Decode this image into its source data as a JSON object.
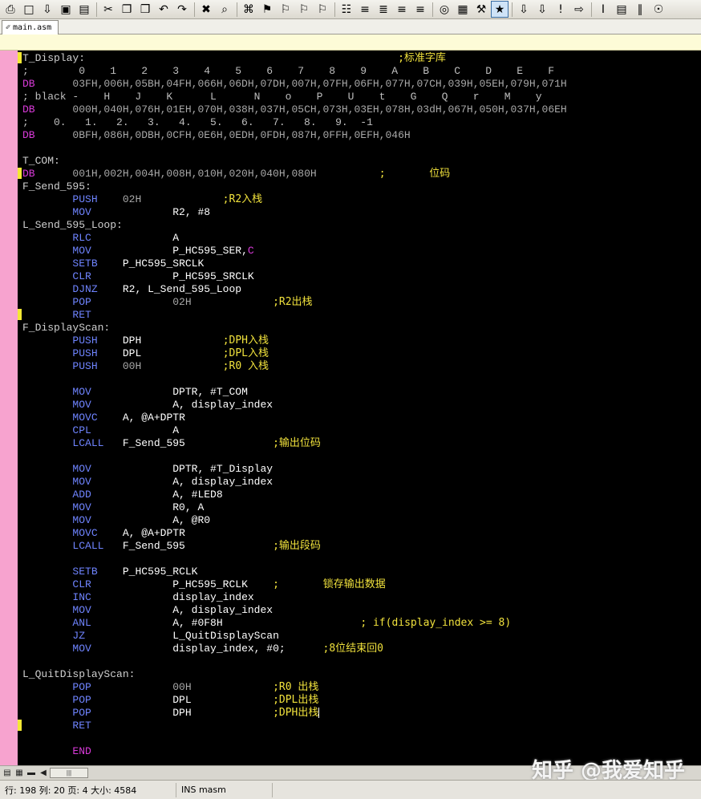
{
  "toolbar": {
    "icons": [
      "⎙",
      "□",
      "⇩",
      "▣",
      "▤",
      "✂",
      "❐",
      "❒",
      "↶",
      "↷",
      "✖",
      "⌕",
      "⌘",
      "⚑",
      "⚐",
      "⚐",
      "⚐",
      "☷",
      "≡",
      "≣",
      "≡",
      "≡",
      "◎",
      "▦",
      "⚒",
      "★",
      "⇩",
      "⇩",
      "!",
      "⇨",
      "I",
      "▤",
      "∥",
      "☉"
    ]
  },
  "tab": {
    "label": "main.asm",
    "icon": "✐"
  },
  "status": {
    "position": "行: 198  列: 20  页: 4  大小: 4584",
    "mode": "INS  masm"
  },
  "watermark": "知乎 @我爱知乎",
  "code_lines": [
    [
      [
        "lbl",
        "T_Display:"
      ],
      [
        "t",
        "                                                  "
      ],
      [
        "cmt",
        ";标准字库"
      ]
    ],
    [
      [
        "t",
        ";        0    1    2    3    4    5    6    7    8    9    A    B    C    D    E    F"
      ]
    ],
    [
      [
        "kp",
        "DB"
      ],
      [
        "num",
        "      03FH,006H,05BH,04FH,066H,06DH,07DH,007H,07FH,06FH,077H,07CH,039H,05EH,079H,071H"
      ]
    ],
    [
      [
        "t",
        "; black -    H    J    K      L      N    o    P    U    t    G    Q    r    M    y"
      ]
    ],
    [
      [
        "kp",
        "DB"
      ],
      [
        "num",
        "      000H,040H,076H,01EH,070H,038H,037H,05CH,073H,03EH,078H,03dH,067H,050H,037H,06EH"
      ]
    ],
    [
      [
        "t",
        ";    0.   1.   2.   3.   4.   5.   6.   7.   8.   9.  -1"
      ]
    ],
    [
      [
        "kp",
        "DB"
      ],
      [
        "num",
        "      0BFH,086H,0DBH,0CFH,0E6H,0EDH,0FDH,087H,0FFH,0EFH,046H"
      ]
    ],
    [],
    [
      [
        "lbl",
        "T_COM:"
      ]
    ],
    [
      [
        "kp",
        "DB"
      ],
      [
        "num",
        "      001H,002H,004H,008H,010H,020H,040H,080H"
      ],
      [
        "t",
        "          "
      ],
      [
        "cmt",
        ";       位码"
      ]
    ],
    [
      [
        "lbl",
        "F_Send_595:"
      ]
    ],
    [
      [
        "t",
        "        "
      ],
      [
        "kw",
        "PUSH"
      ],
      [
        "num",
        "    02H"
      ],
      [
        "t",
        "             "
      ],
      [
        "cmt",
        ";R2入栈"
      ]
    ],
    [
      [
        "t",
        "        "
      ],
      [
        "kw",
        "MOV"
      ],
      [
        "t",
        "             "
      ],
      [
        "m",
        "R2, #8"
      ]
    ],
    [
      [
        "lbl",
        "L_Send_595_Loop:"
      ]
    ],
    [
      [
        "t",
        "        "
      ],
      [
        "kw",
        "RLC"
      ],
      [
        "t",
        "             "
      ],
      [
        "m",
        "A"
      ]
    ],
    [
      [
        "t",
        "        "
      ],
      [
        "kw",
        "MOV"
      ],
      [
        "t",
        "             "
      ],
      [
        "m",
        "P_HC595_SER,"
      ],
      [
        "kp",
        "C"
      ]
    ],
    [
      [
        "t",
        "        "
      ],
      [
        "kw",
        "SETB"
      ],
      [
        "t",
        "    "
      ],
      [
        "m",
        "P_HC595_SRCLK"
      ]
    ],
    [
      [
        "t",
        "        "
      ],
      [
        "kw",
        "CLR"
      ],
      [
        "t",
        "             "
      ],
      [
        "m",
        "P_HC595_SRCLK"
      ]
    ],
    [
      [
        "t",
        "        "
      ],
      [
        "kw",
        "DJNZ"
      ],
      [
        "t",
        "    "
      ],
      [
        "m",
        "R2, L_Send_595_Loop"
      ]
    ],
    [
      [
        "t",
        "        "
      ],
      [
        "kw",
        "POP"
      ],
      [
        "num",
        "             02H"
      ],
      [
        "t",
        "             "
      ],
      [
        "cmt",
        ";R2出栈"
      ]
    ],
    [
      [
        "t",
        "        "
      ],
      [
        "kw",
        "RET"
      ]
    ],
    [
      [
        "lbl",
        "F_DisplayScan:"
      ]
    ],
    [
      [
        "t",
        "        "
      ],
      [
        "kw",
        "PUSH"
      ],
      [
        "t",
        "    "
      ],
      [
        "m",
        "DPH"
      ],
      [
        "t",
        "             "
      ],
      [
        "cmt",
        ";DPH入栈"
      ]
    ],
    [
      [
        "t",
        "        "
      ],
      [
        "kw",
        "PUSH"
      ],
      [
        "t",
        "    "
      ],
      [
        "m",
        "DPL"
      ],
      [
        "t",
        "             "
      ],
      [
        "cmt",
        ";DPL入栈"
      ]
    ],
    [
      [
        "t",
        "        "
      ],
      [
        "kw",
        "PUSH"
      ],
      [
        "num",
        "    00H"
      ],
      [
        "t",
        "             "
      ],
      [
        "cmt",
        ";R0 入栈"
      ]
    ],
    [],
    [
      [
        "t",
        "        "
      ],
      [
        "kw",
        "MOV"
      ],
      [
        "t",
        "             "
      ],
      [
        "m",
        "DPTR, #T_COM"
      ]
    ],
    [
      [
        "t",
        "        "
      ],
      [
        "kw",
        "MOV"
      ],
      [
        "t",
        "             "
      ],
      [
        "m",
        "A, display_index"
      ]
    ],
    [
      [
        "t",
        "        "
      ],
      [
        "kw",
        "MOVC"
      ],
      [
        "t",
        "    "
      ],
      [
        "m",
        "A, @A+DPTR"
      ]
    ],
    [
      [
        "t",
        "        "
      ],
      [
        "kw",
        "CPL"
      ],
      [
        "t",
        "             "
      ],
      [
        "m",
        "A"
      ]
    ],
    [
      [
        "t",
        "        "
      ],
      [
        "kw",
        "LCALL"
      ],
      [
        "t",
        "   "
      ],
      [
        "m",
        "F_Send_595"
      ],
      [
        "t",
        "              "
      ],
      [
        "cmt",
        ";输出位码"
      ]
    ],
    [],
    [
      [
        "t",
        "        "
      ],
      [
        "kw",
        "MOV"
      ],
      [
        "t",
        "             "
      ],
      [
        "m",
        "DPTR, #T_Display"
      ]
    ],
    [
      [
        "t",
        "        "
      ],
      [
        "kw",
        "MOV"
      ],
      [
        "t",
        "             "
      ],
      [
        "m",
        "A, display_index"
      ]
    ],
    [
      [
        "t",
        "        "
      ],
      [
        "kw",
        "ADD"
      ],
      [
        "t",
        "             "
      ],
      [
        "m",
        "A, #LED8"
      ]
    ],
    [
      [
        "t",
        "        "
      ],
      [
        "kw",
        "MOV"
      ],
      [
        "t",
        "             "
      ],
      [
        "m",
        "R0, A"
      ]
    ],
    [
      [
        "t",
        "        "
      ],
      [
        "kw",
        "MOV"
      ],
      [
        "t",
        "             "
      ],
      [
        "m",
        "A, @R0"
      ]
    ],
    [
      [
        "t",
        "        "
      ],
      [
        "kw",
        "MOVC"
      ],
      [
        "t",
        "    "
      ],
      [
        "m",
        "A, @A+DPTR"
      ]
    ],
    [
      [
        "t",
        "        "
      ],
      [
        "kw",
        "LCALL"
      ],
      [
        "t",
        "   "
      ],
      [
        "m",
        "F_Send_595"
      ],
      [
        "t",
        "              "
      ],
      [
        "cmt",
        ";输出段码"
      ]
    ],
    [],
    [
      [
        "t",
        "        "
      ],
      [
        "kw",
        "SETB"
      ],
      [
        "t",
        "    "
      ],
      [
        "m",
        "P_HC595_RCLK"
      ]
    ],
    [
      [
        "t",
        "        "
      ],
      [
        "kw",
        "CLR"
      ],
      [
        "t",
        "             "
      ],
      [
        "m",
        "P_HC595_RCLK"
      ],
      [
        "t",
        "    "
      ],
      [
        "cmt",
        ";       锁存输出数据"
      ]
    ],
    [
      [
        "t",
        "        "
      ],
      [
        "kw",
        "INC"
      ],
      [
        "t",
        "             "
      ],
      [
        "m",
        "display_index"
      ]
    ],
    [
      [
        "t",
        "        "
      ],
      [
        "kw",
        "MOV"
      ],
      [
        "t",
        "             "
      ],
      [
        "m",
        "A, display_index"
      ]
    ],
    [
      [
        "t",
        "        "
      ],
      [
        "kw",
        "ANL"
      ],
      [
        "t",
        "             "
      ],
      [
        "m",
        "A, #0F8H"
      ],
      [
        "t",
        "                      "
      ],
      [
        "cmt",
        "; if(display_index >= 8)"
      ]
    ],
    [
      [
        "t",
        "        "
      ],
      [
        "kw",
        "JZ"
      ],
      [
        "t",
        "              "
      ],
      [
        "m",
        "L_QuitDisplayScan"
      ]
    ],
    [
      [
        "t",
        "        "
      ],
      [
        "kw",
        "MOV"
      ],
      [
        "t",
        "             "
      ],
      [
        "m",
        "display_index, #0;"
      ],
      [
        "t",
        "      "
      ],
      [
        "cmt",
        ";8位结束回0"
      ]
    ],
    [],
    [
      [
        "lbl",
        "L_QuitDisplayScan:"
      ]
    ],
    [
      [
        "t",
        "        "
      ],
      [
        "kw",
        "POP"
      ],
      [
        "num",
        "             00H"
      ],
      [
        "t",
        "             "
      ],
      [
        "cmt",
        ";R0 出栈"
      ]
    ],
    [
      [
        "t",
        "        "
      ],
      [
        "kw",
        "POP"
      ],
      [
        "t",
        "             "
      ],
      [
        "m",
        "DPL"
      ],
      [
        "t",
        "             "
      ],
      [
        "cmt",
        ";DPL出栈"
      ]
    ],
    [
      [
        "t",
        "        "
      ],
      [
        "kw",
        "POP"
      ],
      [
        "t",
        "             "
      ],
      [
        "m",
        "DPH"
      ],
      [
        "t",
        "             "
      ],
      [
        "cmt",
        ";DPH出栈"
      ],
      [
        "cursor",
        ""
      ]
    ],
    [
      [
        "t",
        "        "
      ],
      [
        "kw",
        "RET"
      ]
    ],
    [],
    [
      [
        "t",
        "        "
      ],
      [
        "kp",
        "END"
      ]
    ]
  ]
}
